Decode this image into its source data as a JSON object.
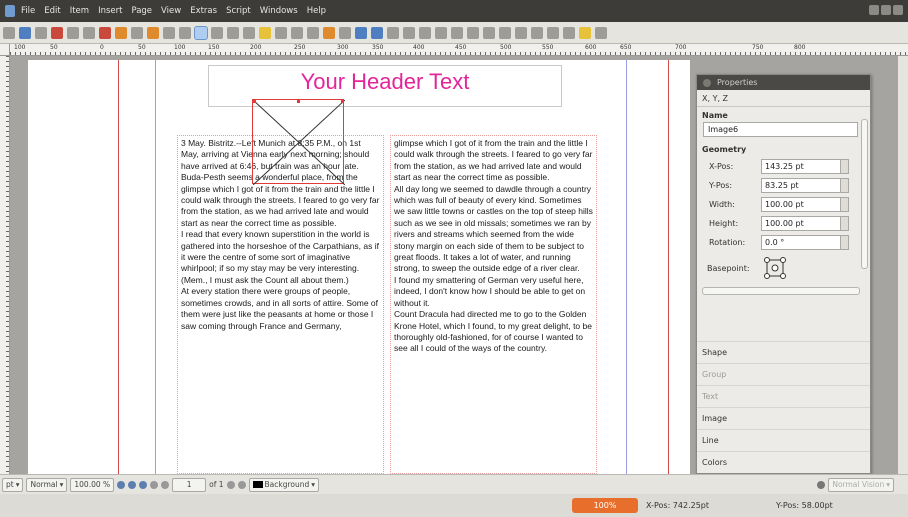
{
  "menubar": {
    "items": [
      "File",
      "Edit",
      "Item",
      "Insert",
      "Page",
      "View",
      "Extras",
      "Script",
      "Windows",
      "Help"
    ]
  },
  "ruler": {
    "labels": [
      "100",
      "50",
      "0",
      "50",
      "100",
      "150",
      "200",
      "250",
      "300",
      "350",
      "400",
      "450",
      "500",
      "550",
      "600",
      "650",
      "700",
      "750",
      "800"
    ]
  },
  "page": {
    "header": "Your Header Text",
    "col1": [
      "3 May. Bistritz.--Left Munich at 8:35 P.M., on 1st May, arriving at Vienna early next morning; should have arrived at 6:46, but train was an hour late. Buda-Pesth seems a wonderful place, from the glimpse which I got of it from the train and the little I could walk through the streets. I feared to go very far from the station, as we had arrived late and would start as near the correct time as possible.",
      "I read that every known superstition in the world is gathered into the horseshoe of the Carpathians, as if it were the centre of some sort of imaginative whirlpool; if so my stay may be very interesting. (Mem., I must ask the Count all about them.)",
      "At every station there were groups of people, sometimes crowds, and in all sorts of attire. Some of them were just like the peasants at home or those I saw coming through France and Germany,"
    ],
    "col2": [
      "glimpse which I got of it from the train and the little I could walk through the streets. I feared to go very far from the station, as we had arrived late and would start as near the correct time as possible.",
      "All day long we seemed to dawdle through a country which was full of beauty of every kind. Sometimes we saw little towns or castles on the top of steep hills such as we see in old missals; sometimes we ran by rivers and streams which seemed from the wide stony margin on each side of them to be subject to great floods. It takes a lot of water, and running strong, to sweep the outside edge of a river clear.",
      "I found my smattering of German very useful here, indeed, I don't know how I should be able to get on without it.",
      "Count Dracula had directed me to go to the Golden Krone Hotel, which I found, to my great delight, to be thoroughly old-fashioned, for of course I wanted to see all I could of the ways of the country."
    ]
  },
  "properties": {
    "title": "Properties",
    "xyz_label": "X, Y, Z",
    "name_section": "Name",
    "name_value": "Image6",
    "geometry_section": "Geometry",
    "fields": [
      {
        "label": "X-Pos:",
        "value": "143.25 pt"
      },
      {
        "label": "Y-Pos:",
        "value": "83.25 pt"
      },
      {
        "label": "Width:",
        "value": "100.00 pt"
      },
      {
        "label": "Height:",
        "value": "100.00 pt"
      },
      {
        "label": "Rotation:",
        "value": "0.0 °"
      }
    ],
    "basepoint_label": "Basepoint:",
    "sections": [
      "Shape",
      "Group",
      "Text",
      "Image",
      "Line",
      "Colors"
    ]
  },
  "statusbar": {
    "unit": "pt",
    "mode": "Normal",
    "zoom": "100.00 %",
    "page": "1",
    "page_of": "of 1",
    "layer": "Background",
    "right_mode": "Normal Vision"
  },
  "bottom": {
    "zoom": "100%",
    "xpos": "X-Pos: 742.25pt",
    "ypos": "Y-Pos: 58.00pt"
  }
}
